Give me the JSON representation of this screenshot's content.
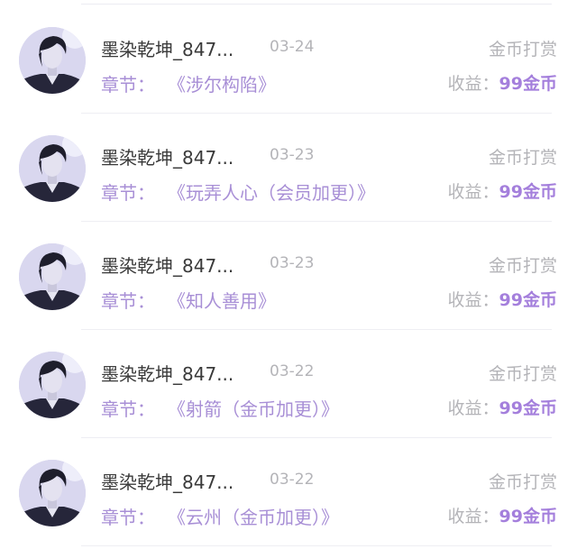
{
  "records": [
    {
      "username": "墨染乾坤_847...",
      "date": "03-24",
      "type": "金币打赏",
      "chapter_label": "章节：",
      "chapter_title": "《涉尔构陷》",
      "earnings_label": "收益：",
      "earnings_value": "99金币"
    },
    {
      "username": "墨染乾坤_847...",
      "date": "03-23",
      "type": "金币打赏",
      "chapter_label": "章节：",
      "chapter_title": "《玩弄人心（会员加更）》",
      "earnings_label": "收益：",
      "earnings_value": "99金币"
    },
    {
      "username": "墨染乾坤_847...",
      "date": "03-23",
      "type": "金币打赏",
      "chapter_label": "章节：",
      "chapter_title": "《知人善用》",
      "earnings_label": "收益：",
      "earnings_value": "99金币"
    },
    {
      "username": "墨染乾坤_847...",
      "date": "03-22",
      "type": "金币打赏",
      "chapter_label": "章节：",
      "chapter_title": "《射箭（金币加更）》",
      "earnings_label": "收益：",
      "earnings_value": "99金币"
    },
    {
      "username": "墨染乾坤_847...",
      "date": "03-22",
      "type": "金币打赏",
      "chapter_label": "章节：",
      "chapter_title": "《云州（金币加更）》",
      "earnings_label": "收益：",
      "earnings_value": "99金币"
    }
  ],
  "colors": {
    "accent": "#a47fdc",
    "chapter": "#a88fd6",
    "muted": "#b4b4b8",
    "text": "#3a3a3a",
    "divider": "#eeeef3"
  },
  "icons": {
    "avatar": "user-avatar-portrait"
  }
}
